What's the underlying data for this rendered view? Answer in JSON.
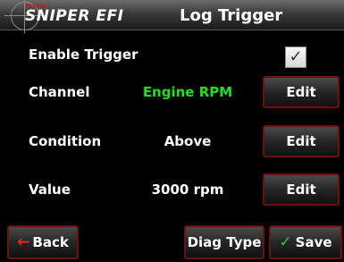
{
  "header": {
    "logo_small": "Holley",
    "logo_text": "SNIPER EFI",
    "title": "Log Trigger"
  },
  "rows": {
    "enable": {
      "label": "Enable Trigger",
      "checked": true,
      "check_glyph": "✓"
    },
    "channel": {
      "label": "Channel",
      "value": "Engine RPM",
      "button": "Edit"
    },
    "condition": {
      "label": "Condition",
      "value": "Above",
      "button": "Edit"
    },
    "value": {
      "label": "Value",
      "value": "3000 rpm",
      "button": "Edit"
    }
  },
  "footer": {
    "back_label": "Back",
    "back_icon": "←",
    "diag_label": "Diag Type",
    "save_label": "Save",
    "save_icon": "✓"
  },
  "colors": {
    "accent_green": "#20e020",
    "button_border": "#6d1010",
    "back_arrow": "#ff2020"
  }
}
